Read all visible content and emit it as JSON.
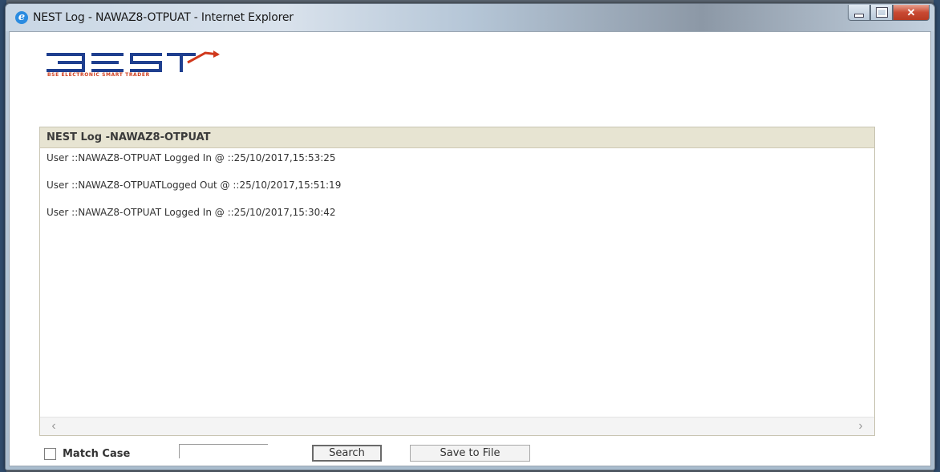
{
  "window": {
    "title": "NEST Log - NAWAZ8-OTPUAT - Internet Explorer",
    "close_glyph": "✕"
  },
  "logo": {
    "text": "BEST",
    "tagline": "BSE ELECTRONIC SMART TRADER",
    "colors": {
      "primary": "#1f3f8f",
      "accent": "#d0381c"
    }
  },
  "panel": {
    "header": "NEST Log -NAWAZ8-OTPUAT",
    "entries": [
      "User ::NAWAZ8-OTPUAT Logged In @ ::25/10/2017,15:53:25",
      "User ::NAWAZ8-OTPUATLogged Out @ ::25/10/2017,15:51:19",
      "User ::NAWAZ8-OTPUAT Logged In @ ::25/10/2017,15:30:42"
    ],
    "scroll_left_glyph": "‹",
    "scroll_right_glyph": "›"
  },
  "controls": {
    "match_case_label": "Match Case",
    "match_case_checked": false,
    "search_value": "",
    "search_button": "Search",
    "save_button": "Save to File"
  }
}
